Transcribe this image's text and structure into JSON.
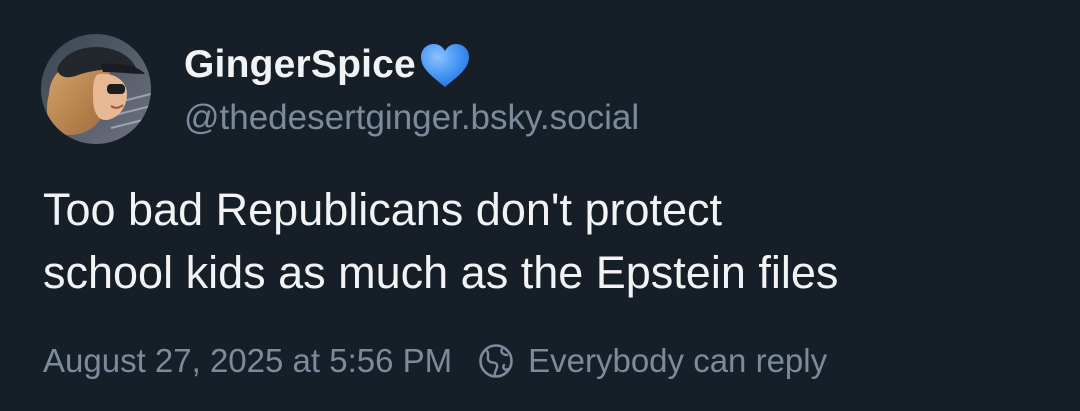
{
  "author": {
    "display_name": "GingerSpice",
    "handle": "@thedesertginger.bsky.social",
    "badge_icon": "blue-heart-icon",
    "avatar_icon": "profile-photo"
  },
  "post": {
    "text_line_1": "Too bad Republicans don't protect",
    "text_line_2": "school kids as much as the Epstein files"
  },
  "meta": {
    "timestamp": "August 27, 2025 at 5:56 PM",
    "reply_setting_icon": "globe-icon",
    "reply_setting": "Everybody can reply"
  },
  "colors": {
    "background": "#161e27",
    "text_primary": "#f1f3f5",
    "text_secondary": "#7b8b9c",
    "heart": "#3d8ef5"
  }
}
